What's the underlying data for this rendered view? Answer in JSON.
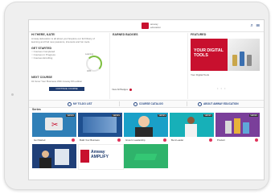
{
  "header": {
    "brand": "amway education",
    "icons": [
      "search-icon",
      "menu-icon"
    ]
  },
  "welcome": {
    "title": "HI THERE, KATE!",
    "subtitle": "Amway Education is all about you! Explore our full library of learning and find new passions, interests and fun tools.",
    "getting_started": "GET STARTED",
    "checklist": [
      "Courses Completed",
      "Courses in Progress",
      "Courses Enrolling"
    ],
    "progress_label": "Learning",
    "progress_value": "40%",
    "progress_fraction": 0.4,
    "next_course_title": "NEXT COURSE",
    "next_course_sub": "01 Grow Your Business With Amway 8th edition",
    "continue_label": "CONTINUE COURSE"
  },
  "badges": {
    "title": "EARNED BADGES",
    "view_all": "View All Badges"
  },
  "featured": {
    "title": "FEATURED",
    "promo_text": "YOUR DIGITAL TOOLS",
    "caption": "Your Digital Tools"
  },
  "actions": [
    {
      "label": "MY TO-DO LIST",
      "icon": "list-icon"
    },
    {
      "label": "COURSE CATALOG",
      "icon": "catalog-icon"
    },
    {
      "label": "ABOUT AMWAY EDUCATION",
      "icon": "info-icon"
    }
  ],
  "series": {
    "title": "Series",
    "tiles": [
      {
        "caption": "Get Started",
        "badge": "SERIES"
      },
      {
        "caption": "Build Your Business",
        "badge": "SERIES"
      },
      {
        "caption": "Grow In Leadership",
        "badge": "SERIES"
      },
      {
        "caption": "Be A Leader",
        "badge": "SERIES"
      },
      {
        "caption": "Product",
        "badge": "SERIES"
      },
      {
        "caption": "",
        "badge": ""
      },
      {
        "caption": "Amway AMPLIFY",
        "badge": ""
      },
      {
        "caption": "",
        "badge": ""
      }
    ]
  },
  "colors": {
    "brand_red": "#c8102e",
    "navy": "#1d3a6e",
    "link_blue": "#2a4b86"
  }
}
